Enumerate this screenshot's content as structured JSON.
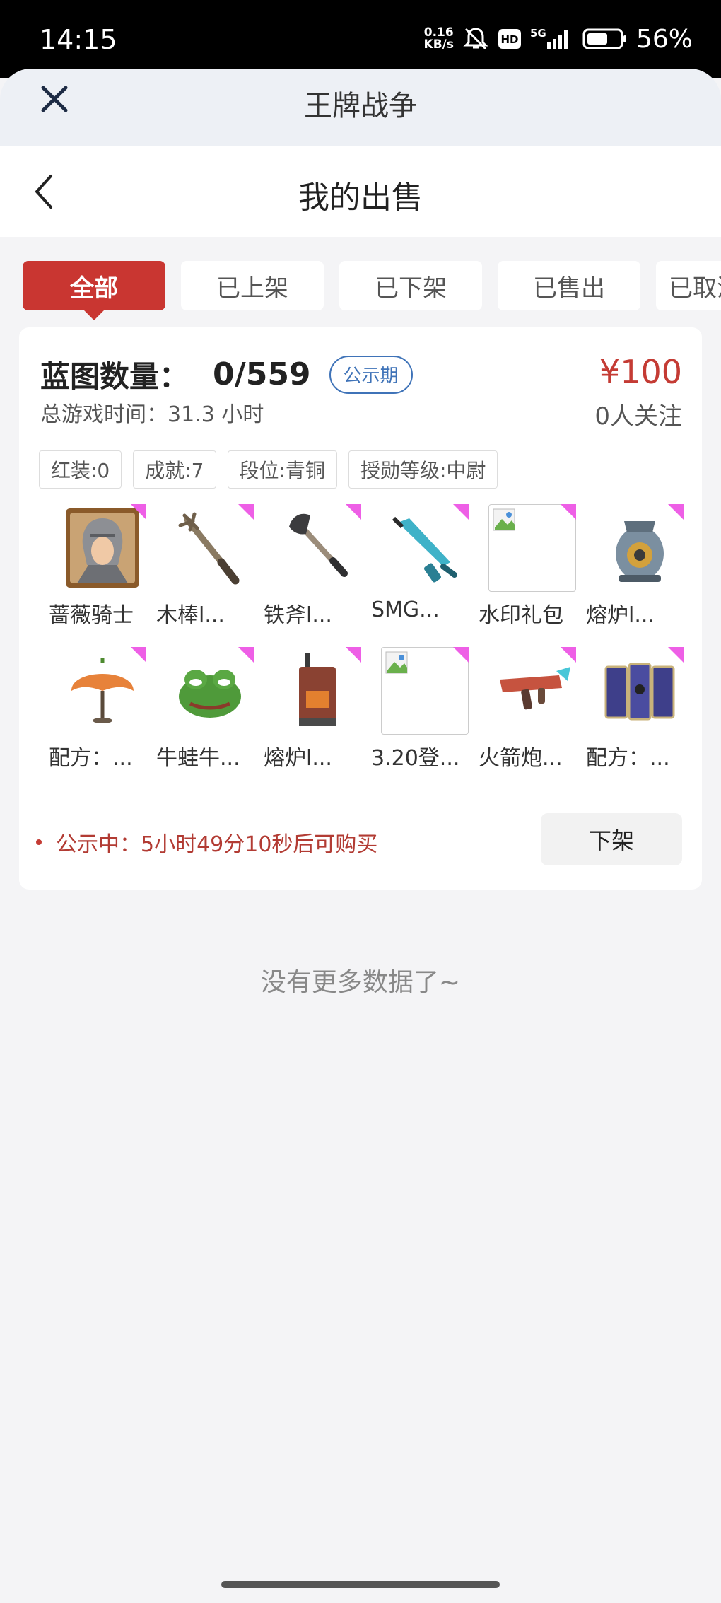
{
  "status_bar": {
    "time": "14:15",
    "net_speed_value": "0.16",
    "net_speed_unit": "KB/s",
    "hd": "HD",
    "network": "5G",
    "battery": "56%",
    "icons": [
      "mute-bell-icon",
      "hd-icon",
      "signal-5g-icon",
      "battery-icon"
    ]
  },
  "sheet": {
    "title": "王牌战争",
    "close_icon": "close-icon"
  },
  "nav": {
    "title": "我的出售",
    "back_icon": "chevron-left-icon"
  },
  "tabs": [
    {
      "label": "全部",
      "active": true
    },
    {
      "label": "已上架",
      "active": false
    },
    {
      "label": "已下架",
      "active": false
    },
    {
      "label": "已售出",
      "active": false
    },
    {
      "label": "已取消",
      "active": false
    }
  ],
  "listing": {
    "blueprint_label": "蓝图数量：",
    "blueprint_value": "0/559",
    "badge": "公示期",
    "playtime": "总游戏时间：31.3 小时",
    "price": "¥100",
    "followers": "0人关注",
    "tags": [
      "红装:0",
      "成就:7",
      "段位:青铜",
      "授勋等级:中尉"
    ],
    "items": [
      {
        "name": "蔷薇骑士",
        "icon": "knight-portrait-icon"
      },
      {
        "name": "木棒l...",
        "icon": "wooden-club-icon"
      },
      {
        "name": "铁斧l...",
        "icon": "iron-axe-icon"
      },
      {
        "name": "SMG...",
        "icon": "smg-icon"
      },
      {
        "name": "水印礼包",
        "icon": "broken-image-icon"
      },
      {
        "name": "熔炉l...",
        "icon": "furnace-pot-icon"
      },
      {
        "name": "配方：...",
        "icon": "pumpkin-umbrella-icon"
      },
      {
        "name": "牛蛙牛...",
        "icon": "frog-mask-icon"
      },
      {
        "name": "熔炉l...",
        "icon": "furnace-tower-icon"
      },
      {
        "name": "3.20登...",
        "icon": "broken-image-icon"
      },
      {
        "name": "火箭炮...",
        "icon": "rocket-launcher-icon"
      },
      {
        "name": "配方：...",
        "icon": "blueprint-panel-icon"
      }
    ],
    "notice": "公示中：5小时49分10秒后可购买",
    "delist_button": "下架"
  },
  "footer": {
    "no_more": "没有更多数据了~"
  },
  "colors": {
    "accent_red": "#c93631",
    "badge_blue": "#3f73b8",
    "corner_pink": "#ee5fe6"
  }
}
